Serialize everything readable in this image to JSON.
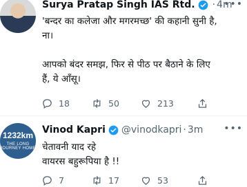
{
  "tweets": [
    {
      "author": "Surya Pratap Singh IAS Rtd.",
      "handle": "",
      "time": "4m",
      "text_lines": [
        "'बन्दर का कलेजा और मगरमच्छ' की कहानी सुनी है,",
        "ना।"
      ],
      "text_lines_2": [
        "आपको बंदर समझ, फिर से पीठ पर बैठाने के लिए",
        "हैं, ये आँसू।"
      ],
      "replies": "18",
      "retweets": "50",
      "likes": "213"
    },
    {
      "author": "Vinod Kapri",
      "handle": "@vinodkapri",
      "time": "3m",
      "avatar_text": "1232km",
      "avatar_subtext": "THE LONG JOURNEY HOME",
      "text_lines": [
        "चेतावनी याद रहे",
        "वायरस बहुरूपिया है !!"
      ],
      "replies": "7",
      "retweets": "17",
      "likes": "53"
    }
  ],
  "icons": {
    "verified": "verified-badge-icon",
    "more": "more-icon",
    "reply": "reply-icon",
    "retweet": "retweet-icon",
    "like": "like-icon",
    "share": "share-icon"
  },
  "colors": {
    "verified": "#1d9bf0",
    "muted": "#536471",
    "text": "#0f1419"
  }
}
